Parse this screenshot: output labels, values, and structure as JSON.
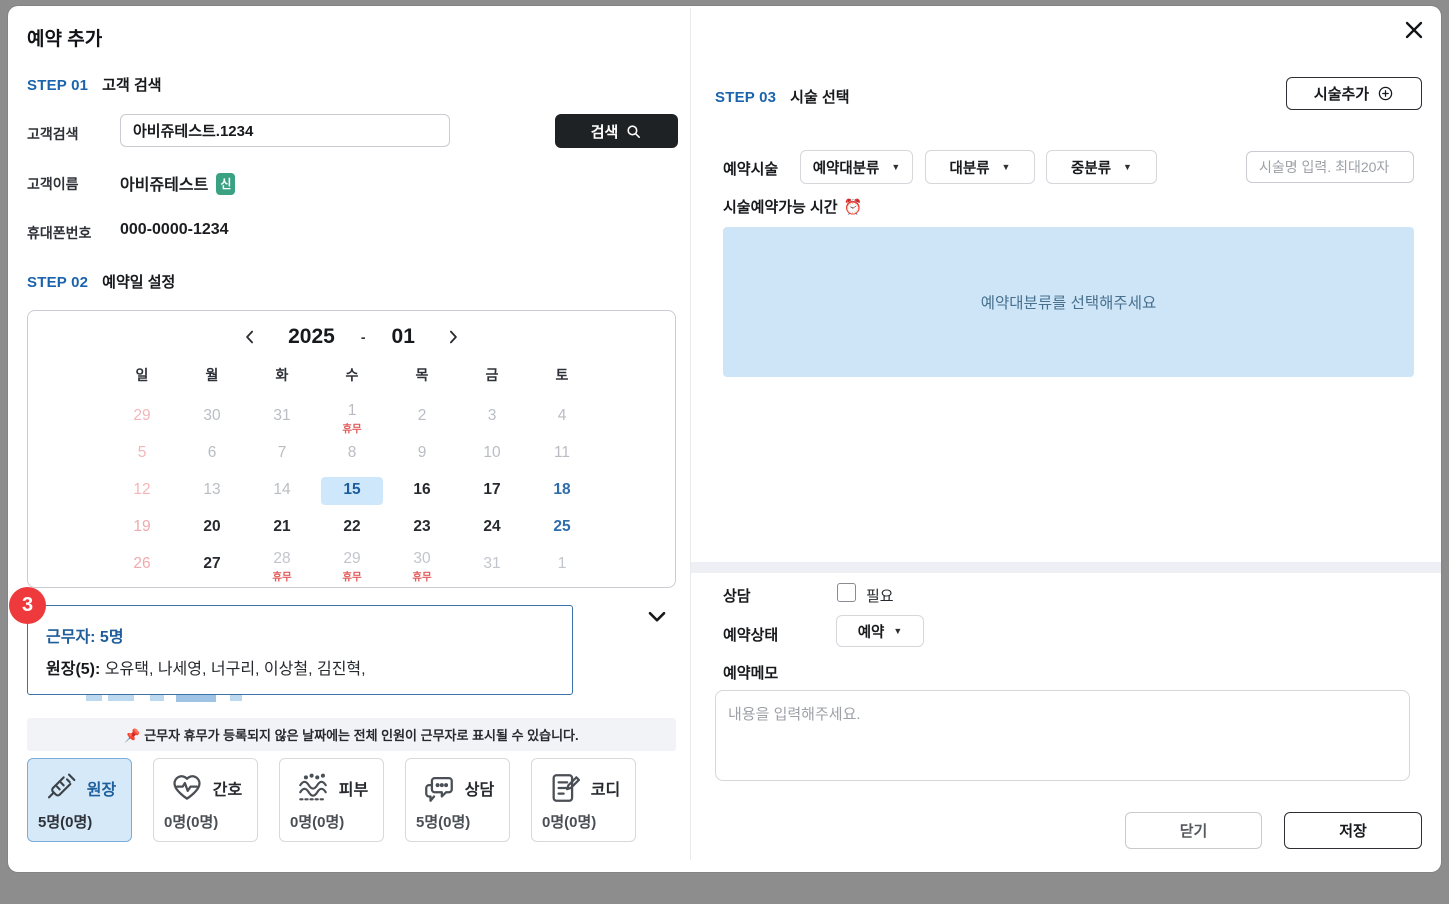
{
  "modal": {
    "title": "예약 추가"
  },
  "step1": {
    "step_label": "STEP 01",
    "title": "고객 검색",
    "search_label": "고객검색",
    "search_value": "아비쥬테스트.1234",
    "search_button": "검색",
    "name_label": "고객이름",
    "name_value": "아비쥬테스트",
    "name_badge": "신",
    "phone_label": "휴대폰번호",
    "phone_value": "000-0000-1234"
  },
  "step2": {
    "step_label": "STEP 02",
    "title": "예약일 설정",
    "calendar": {
      "year": "2025",
      "separator": "-",
      "month": "01",
      "weekdays": [
        "일",
        "월",
        "화",
        "수",
        "목",
        "금",
        "토"
      ],
      "weeks": [
        [
          {
            "d": "29",
            "t": "sun-past"
          },
          {
            "d": "30",
            "t": "past"
          },
          {
            "d": "31",
            "t": "past"
          },
          {
            "d": "1",
            "t": "past",
            "label": "휴무"
          },
          {
            "d": "2",
            "t": "past"
          },
          {
            "d": "3",
            "t": "past"
          },
          {
            "d": "4",
            "t": "past"
          }
        ],
        [
          {
            "d": "5",
            "t": "sun-past"
          },
          {
            "d": "6",
            "t": "past"
          },
          {
            "d": "7",
            "t": "past"
          },
          {
            "d": "8",
            "t": "past"
          },
          {
            "d": "9",
            "t": "past"
          },
          {
            "d": "10",
            "t": "past"
          },
          {
            "d": "11",
            "t": "past"
          }
        ],
        [
          {
            "d": "12",
            "t": "sun-past"
          },
          {
            "d": "13",
            "t": "past"
          },
          {
            "d": "14",
            "t": "past"
          },
          {
            "d": "15",
            "t": "selected"
          },
          {
            "d": "16",
            "t": "normal"
          },
          {
            "d": "17",
            "t": "normal"
          },
          {
            "d": "18",
            "t": "sat"
          }
        ],
        [
          {
            "d": "19",
            "t": "sun"
          },
          {
            "d": "20",
            "t": "normal"
          },
          {
            "d": "21",
            "t": "normal"
          },
          {
            "d": "22",
            "t": "normal"
          },
          {
            "d": "23",
            "t": "normal"
          },
          {
            "d": "24",
            "t": "normal"
          },
          {
            "d": "25",
            "t": "sat"
          }
        ],
        [
          {
            "d": "26",
            "t": "sun"
          },
          {
            "d": "27",
            "t": "normal"
          },
          {
            "d": "28",
            "t": "muted",
            "label": "휴무"
          },
          {
            "d": "29",
            "t": "muted",
            "label": "휴무"
          },
          {
            "d": "30",
            "t": "muted",
            "label": "휴무"
          },
          {
            "d": "31",
            "t": "muted"
          },
          {
            "d": "1",
            "t": "muted"
          }
        ]
      ]
    },
    "selected_day": "15",
    "badge_number": "3",
    "workers": {
      "summary": "근무자: 5명",
      "role_label": "원장(5):",
      "names": "오유택, 나세영, 너구리, 이상철, 김진혁,"
    },
    "notice": "📌 근무자 휴무가 등록되지 않은 날짜에는 전체 인원이 근무자로 표시될 수 있습니다.",
    "staff_cards": [
      {
        "label": "원장",
        "count": "5명(0명)",
        "icon": "syringe-icon",
        "selected": true
      },
      {
        "label": "간호",
        "count": "0명(0명)",
        "icon": "heart-pulse-icon",
        "selected": false
      },
      {
        "label": "피부",
        "count": "0명(0명)",
        "icon": "skin-icon",
        "selected": false
      },
      {
        "label": "상담",
        "count": "5명(0명)",
        "icon": "chat-icon",
        "selected": false
      },
      {
        "label": "코디",
        "count": "0명(0명)",
        "icon": "clipboard-pen-icon",
        "selected": false
      }
    ]
  },
  "step3": {
    "step_label": "STEP 03",
    "title": "시술 선택",
    "add_button": "시술추가",
    "procedure_label": "예약시술",
    "dropdowns": [
      {
        "label": "예약대분류"
      },
      {
        "label": "대분류"
      },
      {
        "label": "중분류"
      }
    ],
    "name_input_placeholder": "시술명 입력. 최대20자",
    "time_label": "시술예약가능 시간",
    "time_emoji": "⏰",
    "empty_message": "예약대분류를 선택해주세요"
  },
  "footer": {
    "consult_label": "상담",
    "consult_option": "필요",
    "status_label": "예약상태",
    "status_value": "예약",
    "memo_label": "예약메모",
    "memo_placeholder": "내용을 입력해주세요.",
    "close_button": "닫기",
    "save_button": "저장"
  },
  "colors": {
    "step_blue": "#1b64ad",
    "selected_day_bg": "#cfe7fa",
    "selected_day_text": "#1c5d9c",
    "saturday_blue": "#2e6cab",
    "sunday_pink": "#f0a9ac",
    "holiday_red": "#e25b5b",
    "badge_red": "#ee3a3c",
    "new_badge_teal": "#3ba183",
    "worker_border_blue": "#3d72a8",
    "empty_panel_blue": "#cee5f8",
    "search_button_black": "#1f2225",
    "backdrop_gray": "#8d8d8d"
  }
}
